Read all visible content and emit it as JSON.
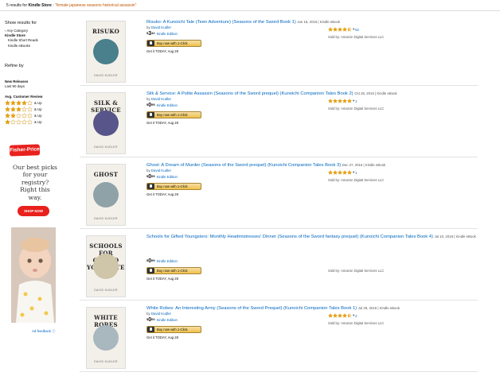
{
  "results_bar": {
    "count": "5 results for",
    "store": "Kindle Store",
    "separator": ":",
    "query": "\"female japanese seasons historical assassin\""
  },
  "sidebar": {
    "title": "Show results for",
    "items": [
      {
        "label": "Any Category",
        "type": "back"
      },
      {
        "label": "Kindle Store",
        "type": "selected"
      },
      {
        "label": "Kindle Short Reads",
        "type": "sub"
      },
      {
        "label": "Kindle eBooks",
        "type": "sub"
      }
    ],
    "refine": "Refine by",
    "new_releases_heading": "New Releases",
    "new_releases_item": "Last 90 days",
    "review_heading": "Avg. Customer Review",
    "review_rows": [
      {
        "stars": 4,
        "label": "& Up"
      },
      {
        "stars": 3,
        "label": "& Up"
      },
      {
        "stars": 2,
        "label": "& Up"
      },
      {
        "stars": 1,
        "label": "& Up"
      }
    ]
  },
  "ad": {
    "brand": "Fisher-Price",
    "headline": "Our best picks for your registry? Right this way.",
    "cta": "SHOP NOW",
    "feedback": "Ad feedback"
  },
  "results": [
    {
      "title": "Risuko: A Kunoichi Tale (Teen Adventure) (Seasons of the Sword Book 1)",
      "meta": "Jun 15, 2016 | Kindle eBook",
      "author": "David Kudler",
      "price_dollars": "3",
      "price_cents": "42",
      "format": "Kindle Edition",
      "buy_label": "Buy now with 1-Click",
      "get_it": "Get it TODAY, Aug 28",
      "rating_stars": 4.5,
      "rating_count": "52",
      "sold_by": "Sold by: Amazon Digital Services LLC",
      "cover_title": "RISUKO",
      "cover_author": "DAVID KUDLER",
      "cover_color": "#4a7f8c"
    },
    {
      "title": "Silk & Service: A Polite Assassin (Seasons of the Sword prequel) (Kunoichi Companion Tales Book 2)",
      "meta": "Oct 26, 2016 | Kindle eBook",
      "author": "David Kudler",
      "price_dollars": "0",
      "price_cents": "99",
      "format": "Kindle Edition",
      "buy_label": "Buy now with 1-Click",
      "get_it": "Get it TODAY, Aug 28",
      "rating_stars": 5,
      "rating_count": "1",
      "sold_by": "Sold by: Amazon Digital Services LLC",
      "cover_title": "SILK & SERVICE",
      "cover_author": "DAVID KUDLER",
      "cover_color": "#58558a"
    },
    {
      "title": "Ghost: A Dream of Murder (Seasons of the Sword prequel) (Kunoichi Companion Tales Book 3)",
      "meta": "Dec 27, 2016 | Kindle eBook",
      "author": "David Kudler",
      "price_dollars": "0",
      "price_cents": "99",
      "format": "Kindle Edition",
      "buy_label": "Buy now with 1-Click",
      "get_it": "Get it TODAY, Aug 28",
      "rating_stars": 5,
      "rating_count": "1",
      "sold_by": "Sold by: Amazon Digital Services LLC",
      "cover_title": "GHOST",
      "cover_author": "DAVID KUDLER",
      "cover_color": "#8fa2a8"
    },
    {
      "title": "Schools for Gifted Youngsters: Monthly Headmistresses' Dinner (Seasons of the Sword fantasy prequel) (Kunoichi Companion Tales Book 4)",
      "meta": "Jul 10, 2018 | Kindle eBook",
      "author": "",
      "price_dollars": "0",
      "price_cents": "99",
      "format": "Kindle Edition",
      "buy_label": "Buy now with 1-Click",
      "get_it": "Get it TODAY, Aug 28",
      "rating_stars": 0,
      "rating_count": "",
      "sold_by": "Sold by: Amazon Digital Services LLC",
      "cover_title": "SCHOOLS FOR GIFTED YOUNGSTERS",
      "cover_author": "DAVID KUDLER",
      "cover_color": "#cfc5a8"
    },
    {
      "title": "White Robes: An Interesting Army (Seasons of the Sword Prequel) (Kunoichi Companion Tales Book 1)",
      "meta": "Jul 29, 2016 | Kindle eBook",
      "author": "David Kudler",
      "price_dollars": "0",
      "price_cents": "00",
      "format": "Kindle Edition",
      "buy_label": "Buy now with 1-Click",
      "get_it": "Get it TODAY, Aug 28",
      "rating_stars": 4.5,
      "rating_count": "2",
      "sold_by": "Sold by: Amazon Digital Services LLC",
      "cover_title": "WHITE ROBES",
      "cover_author": "DAVID KUDLER",
      "cover_color": "#a9b7bf"
    }
  ],
  "colors": {
    "link": "#0066c0",
    "star": "#f0a000",
    "button": "#f0c14b",
    "query": "#c45500"
  }
}
